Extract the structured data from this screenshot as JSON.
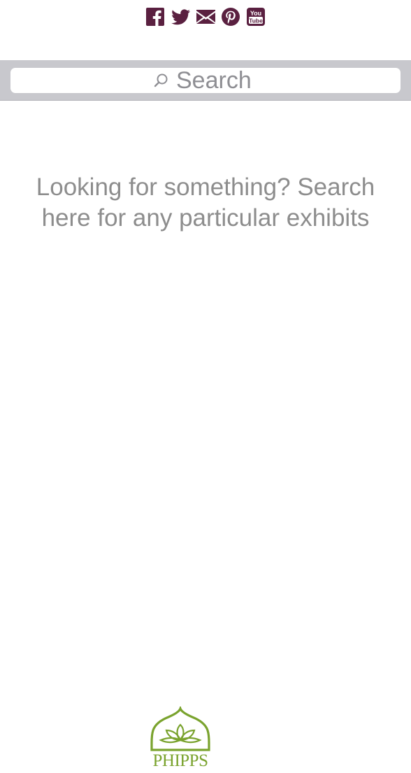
{
  "social": {
    "icons": [
      "facebook-icon",
      "twitter-icon",
      "email-icon",
      "pinterest-icon",
      "youtube-icon"
    ],
    "youtube_label_top": "You",
    "youtube_label_bottom": "Tube",
    "color": "#5a2040"
  },
  "search": {
    "placeholder": "Search",
    "bar_color": "#c8c8cd"
  },
  "prompt": {
    "text": "Looking for something? Search here for any particular exhibits"
  },
  "logo": {
    "text": "PHIPPS",
    "color": "#7aa32e"
  }
}
